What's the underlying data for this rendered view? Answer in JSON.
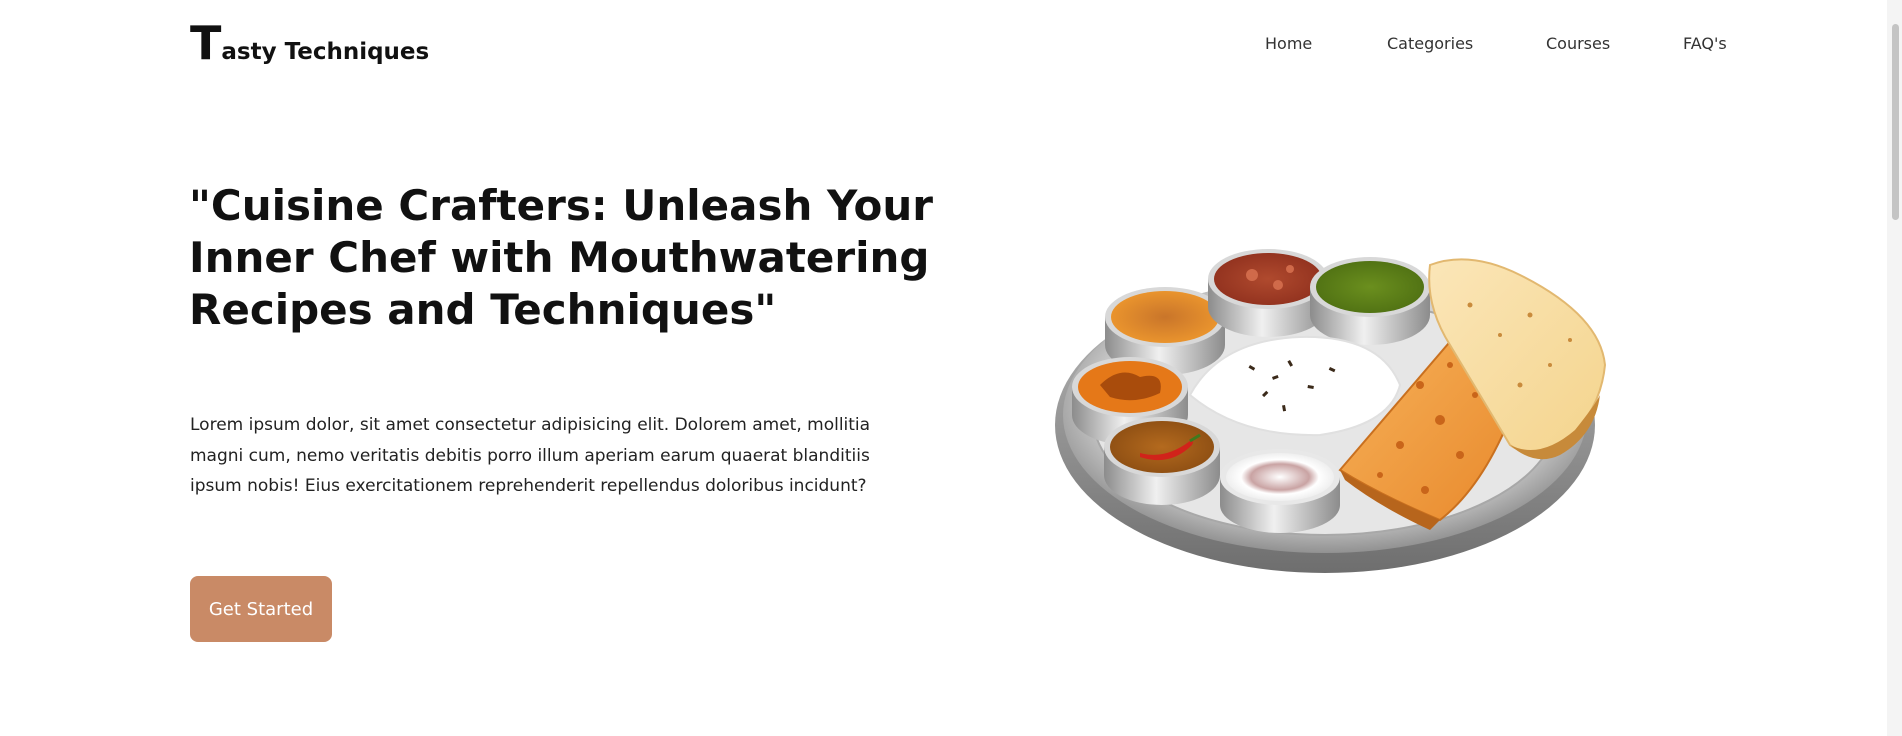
{
  "header": {
    "logo_initial": "T",
    "logo_rest": "asty Techniques",
    "nav": [
      {
        "label": "Home"
      },
      {
        "label": "Categories"
      },
      {
        "label": "Courses"
      },
      {
        "label": "FAQ's"
      }
    ]
  },
  "hero": {
    "title": "\"Cuisine Crafters: Unleash Your Inner Chef with Mouthwatering Recipes and Techniques\"",
    "description": "Lorem ipsum dolor, sit amet consectetur adipisicing elit. Dolorem amet, mollitia magni cum, nemo veritatis debitis porro illum aperiam earum quaerat blanditiis ipsum nobis! Eius exercitationem reprehenderit repellendus doloribus incidunt?",
    "cta_label": "Get Started",
    "image_icon": "thali-plate-illustration"
  },
  "colors": {
    "cta_background": "#c98a66",
    "text_primary": "#111111",
    "background": "#ffffff"
  }
}
